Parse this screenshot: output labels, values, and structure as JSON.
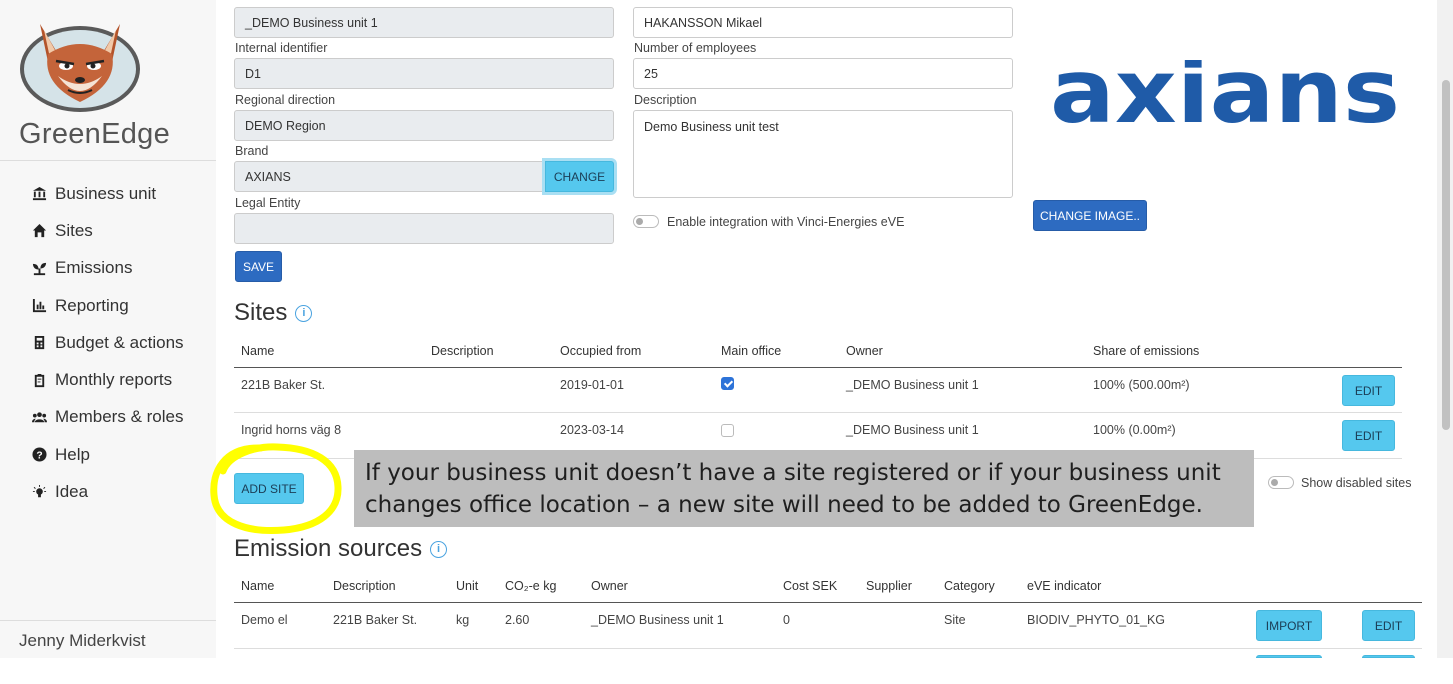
{
  "sidebar": {
    "brand": "GreenEdge",
    "items": [
      {
        "label": "Business unit",
        "icon": "bank-icon"
      },
      {
        "label": "Sites",
        "icon": "home-icon"
      },
      {
        "label": "Emissions",
        "icon": "seedling-icon"
      },
      {
        "label": "Reporting",
        "icon": "chart-icon"
      },
      {
        "label": "Budget & actions",
        "icon": "calculator-icon"
      },
      {
        "label": "Monthly reports",
        "icon": "clipboard-icon"
      },
      {
        "label": "Members & roles",
        "icon": "users-icon"
      },
      {
        "label": "Help",
        "icon": "question-icon"
      },
      {
        "label": "Idea",
        "icon": "lightbulb-icon"
      }
    ],
    "user": "Jenny Miderkvist"
  },
  "form": {
    "name_value": "_DEMO Business unit 1",
    "internal_id_label": "Internal identifier",
    "internal_id_value": "D1",
    "regional_label": "Regional direction",
    "regional_value": "DEMO Region",
    "brand_label": "Brand",
    "brand_value": "AXIANS",
    "change_label": "CHANGE",
    "legal_label": "Legal Entity",
    "legal_value": "",
    "save_label": "SAVE",
    "manager_value": "HAKANSSON Mikael",
    "employees_label": "Number of employees",
    "employees_value": "25",
    "description_label": "Description",
    "description_value": "Demo Business unit test",
    "integration_label": "Enable integration with Vinci-Energies eVE",
    "change_image_label": "CHANGE IMAGE..",
    "logo_text": "axians"
  },
  "sites": {
    "title": "Sites",
    "columns": [
      "Name",
      "Description",
      "Occupied from",
      "Main office",
      "Owner",
      "Share of emissions"
    ],
    "rows": [
      {
        "name": "221B Baker St.",
        "description": "",
        "occupied": "2019-01-01",
        "main_office": true,
        "owner": "_DEMO Business unit 1",
        "share": "100% (500.00m²)",
        "edit": "EDIT"
      },
      {
        "name": "Ingrid horns väg 8",
        "description": "",
        "occupied": "2023-03-14",
        "main_office": false,
        "owner": "_DEMO Business unit 1",
        "share": "100% (0.00m²)",
        "edit": "EDIT"
      }
    ],
    "add_label": "ADD SITE",
    "show_disabled_label": "Show disabled sites"
  },
  "callout": "If your business unit doesn’t have a site registered or if your business unit changes office location – a new site will need to be added to GreenEdge.",
  "emissions": {
    "title": "Emission sources",
    "columns": [
      "Name",
      "Description",
      "Unit",
      "CO₂-e kg",
      "Owner",
      "Cost SEK",
      "Supplier",
      "Category",
      "eVE indicator"
    ],
    "rows": [
      {
        "name": "Demo el",
        "description": "221B Baker St.",
        "unit": "kg",
        "co2": "2.60",
        "owner": "_DEMO Business unit 1",
        "cost": "0",
        "supplier": "",
        "category": "Site",
        "indicator": "BIODIV_PHYTO_01_KG",
        "import": "IMPORT",
        "edit": "EDIT"
      }
    ]
  },
  "colors": {
    "primary": "#2d6bc1",
    "cyan": "#55c8ee",
    "highlight": "#ffff00",
    "axians_blue": "#1f5ba8",
    "axians_magenta": "#a3196b"
  }
}
